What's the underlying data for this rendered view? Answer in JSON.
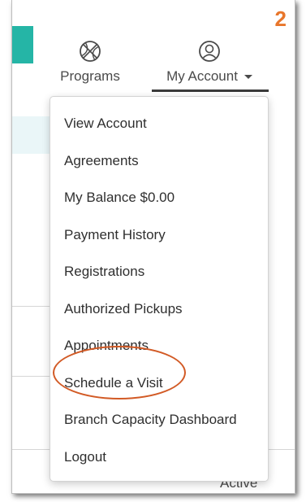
{
  "annotation": {
    "step": "2",
    "highlight_color": "#d25a25",
    "step_color": "#e8762b"
  },
  "nav": {
    "programs": {
      "label": "Programs",
      "icon": "basketball-icon"
    },
    "account": {
      "label": "My Account",
      "icon": "user-circle-icon",
      "caret": "chevron-down-icon"
    }
  },
  "menu": {
    "items": [
      "View Account",
      "Agreements",
      "My Balance $0.00",
      "Payment History",
      "Registrations",
      "Authorized Pickups",
      "Appointments",
      "Schedule a Visit",
      "Branch Capacity Dashboard",
      "Logout"
    ],
    "highlighted": "Schedule a Visit"
  },
  "background": {
    "status_text": "Active"
  },
  "colors": {
    "accent_teal": "#25b5a6",
    "text": "#2f2f2f"
  }
}
